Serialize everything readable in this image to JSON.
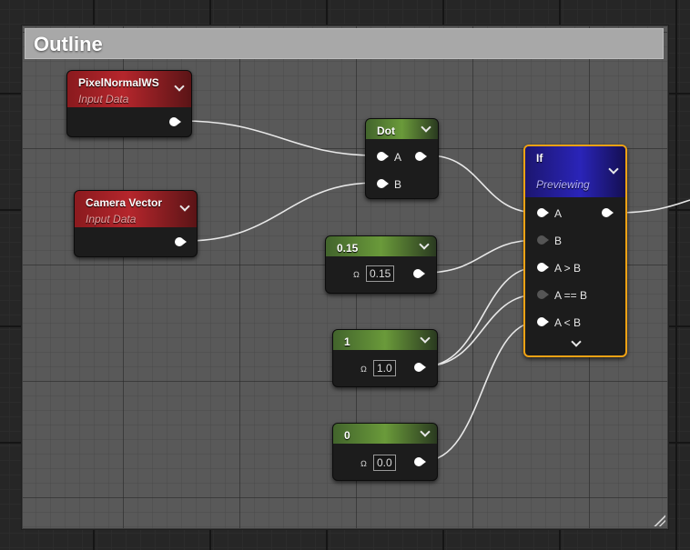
{
  "comment": {
    "title": "Outline"
  },
  "nodes": {
    "pixel_normal": {
      "title": "PixelNormalWS",
      "subtitle": "Input Data"
    },
    "camera_vector": {
      "title": "Camera Vector",
      "subtitle": "Input Data"
    },
    "dot": {
      "title": "Dot",
      "pin_a": "A",
      "pin_b": "B"
    },
    "const_015": {
      "title": "0.15",
      "value": "0.15"
    },
    "const_1": {
      "title": "1",
      "value": "1.0"
    },
    "const_0": {
      "title": "0",
      "value": "0.0"
    },
    "if": {
      "title": "If",
      "subtitle": "Previewing",
      "pins": [
        "A",
        "B",
        "A > B",
        "A == B",
        "A < B"
      ]
    }
  },
  "colors": {
    "input_header": "#b5262c",
    "constant_header": "#6a9a3a",
    "if_header": "#2a24b8",
    "selection_outline": "#f0a214",
    "wire": "#e8e8e8"
  },
  "icons": {
    "expand": "chevron-down-icon",
    "pin": "exec-pin-icon",
    "value": "x-scalar-icon"
  }
}
